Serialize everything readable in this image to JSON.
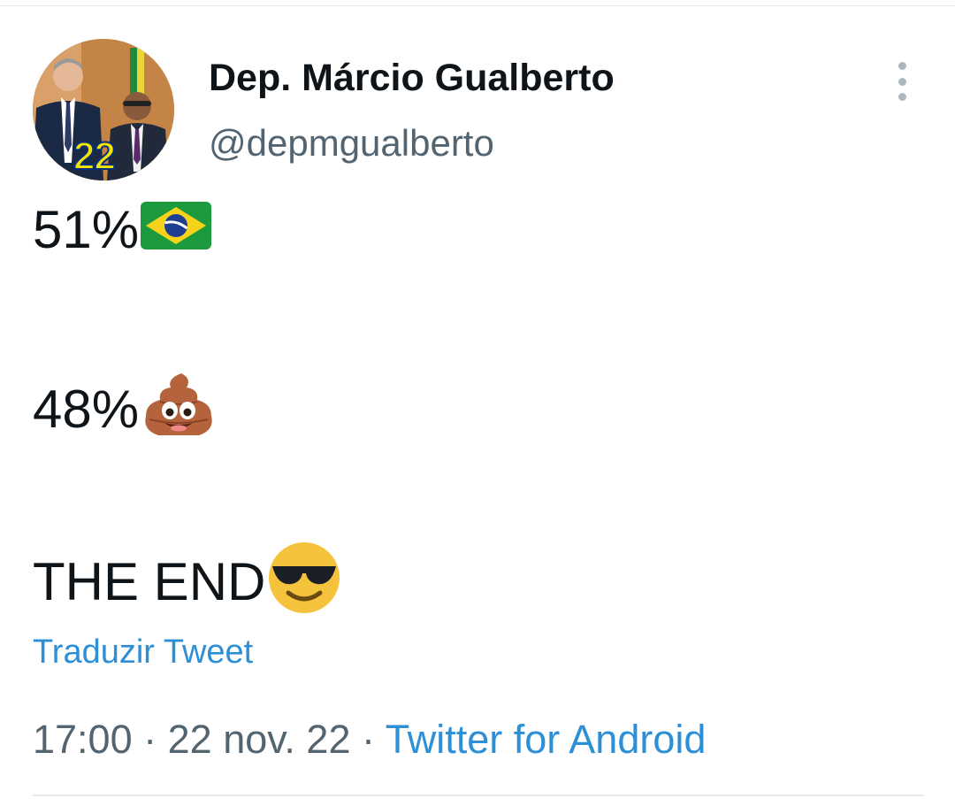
{
  "author": {
    "display_name": "Dep. Márcio Gualberto",
    "username": "@depmgualberto",
    "avatar_badge_number": "22",
    "avatar_icon": "profile-photo"
  },
  "more_menu": {
    "icon": "more-vertical-icon"
  },
  "tweet": {
    "line1_text": "51%",
    "line1_emoji": "brazil-flag-emoji",
    "line2_text": "48%",
    "line2_emoji": "pile-of-poo-emoji",
    "line3_text": "THE END",
    "line3_emoji": "smiling-face-with-sunglasses-emoji"
  },
  "translate_link": "Traduzir Tweet",
  "meta": {
    "time": "17:00",
    "separator": "·",
    "date": "22 nov. 22",
    "source": "Twitter for Android"
  },
  "colors": {
    "link": "#2d8fd6",
    "secondary_text": "#536471",
    "primary_text": "#0f1419"
  }
}
